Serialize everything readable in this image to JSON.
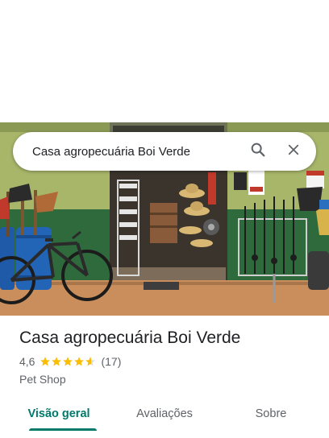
{
  "search": {
    "query": "Casa agropecuária Boi Verde"
  },
  "icons": {
    "search": "search-icon",
    "close": "close-icon",
    "star": "star-icon"
  },
  "place": {
    "name": "Casa agropecuária Boi Verde",
    "rating": "4,6",
    "rating_stars": 4.6,
    "review_count": "(17)",
    "category": "Pet Shop"
  },
  "tabs": [
    {
      "label": "Visão geral",
      "selected": true
    },
    {
      "label": "Avaliações",
      "selected": false
    },
    {
      "label": "Sobre",
      "selected": false
    }
  ],
  "colors": {
    "accent": "#00796b",
    "star": "#fbbc04",
    "star_empty": "#dadce0"
  }
}
